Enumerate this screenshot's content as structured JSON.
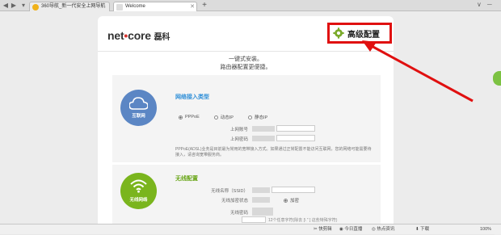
{
  "browser": {
    "tabs": [
      {
        "label": "360导航_新一代安全上网导航",
        "active": false
      },
      {
        "label": "Welcome",
        "active": true
      }
    ],
    "add_tab_label": "+",
    "window_controls": [
      "∨",
      "─",
      "✕"
    ]
  },
  "page": {
    "logo": {
      "brand": "net",
      "dot": "•",
      "brand2": "core",
      "cn": "磊科"
    },
    "advanced_button": "高级配置",
    "intro_line1": "一键式安装。",
    "intro_line2": "路由器配置更便捷。",
    "wan": {
      "badge": "互联网",
      "title": "网络接入类型",
      "options": [
        {
          "label": "PPPoE",
          "selected": true
        },
        {
          "label": "动态IP",
          "selected": false
        },
        {
          "label": "静态IP",
          "selected": false
        }
      ],
      "account_label": "上网账号",
      "password_label": "上网密码",
      "note": "PPPoE(ADSL)业务是目前最为常用的宽带接入方式。如果通过正常配置不能访问互联网，您的网络可能需要待接入，请咨询宽带服务商。"
    },
    "wifi": {
      "badge": "无线网络",
      "title": "无线配置",
      "ssid_label": "无线名称（SSID）",
      "encrypt_label": "无线加密状态",
      "encrypt_value": "加密",
      "password_label": "无线密码",
      "password_hint": "12个任意字符(除去 [\\ \" ] 这些特殊字符)"
    }
  },
  "statusbar": {
    "items": [
      "快剪辑",
      "今日直播",
      "热点资讯",
      "下载",
      "100%"
    ]
  },
  "colors": {
    "highlight": "#e01010",
    "wan_circle": "#5b86c4",
    "wifi_circle": "#7ab51d",
    "title_blue": "#2f8fd8",
    "title_green": "#66a413"
  }
}
